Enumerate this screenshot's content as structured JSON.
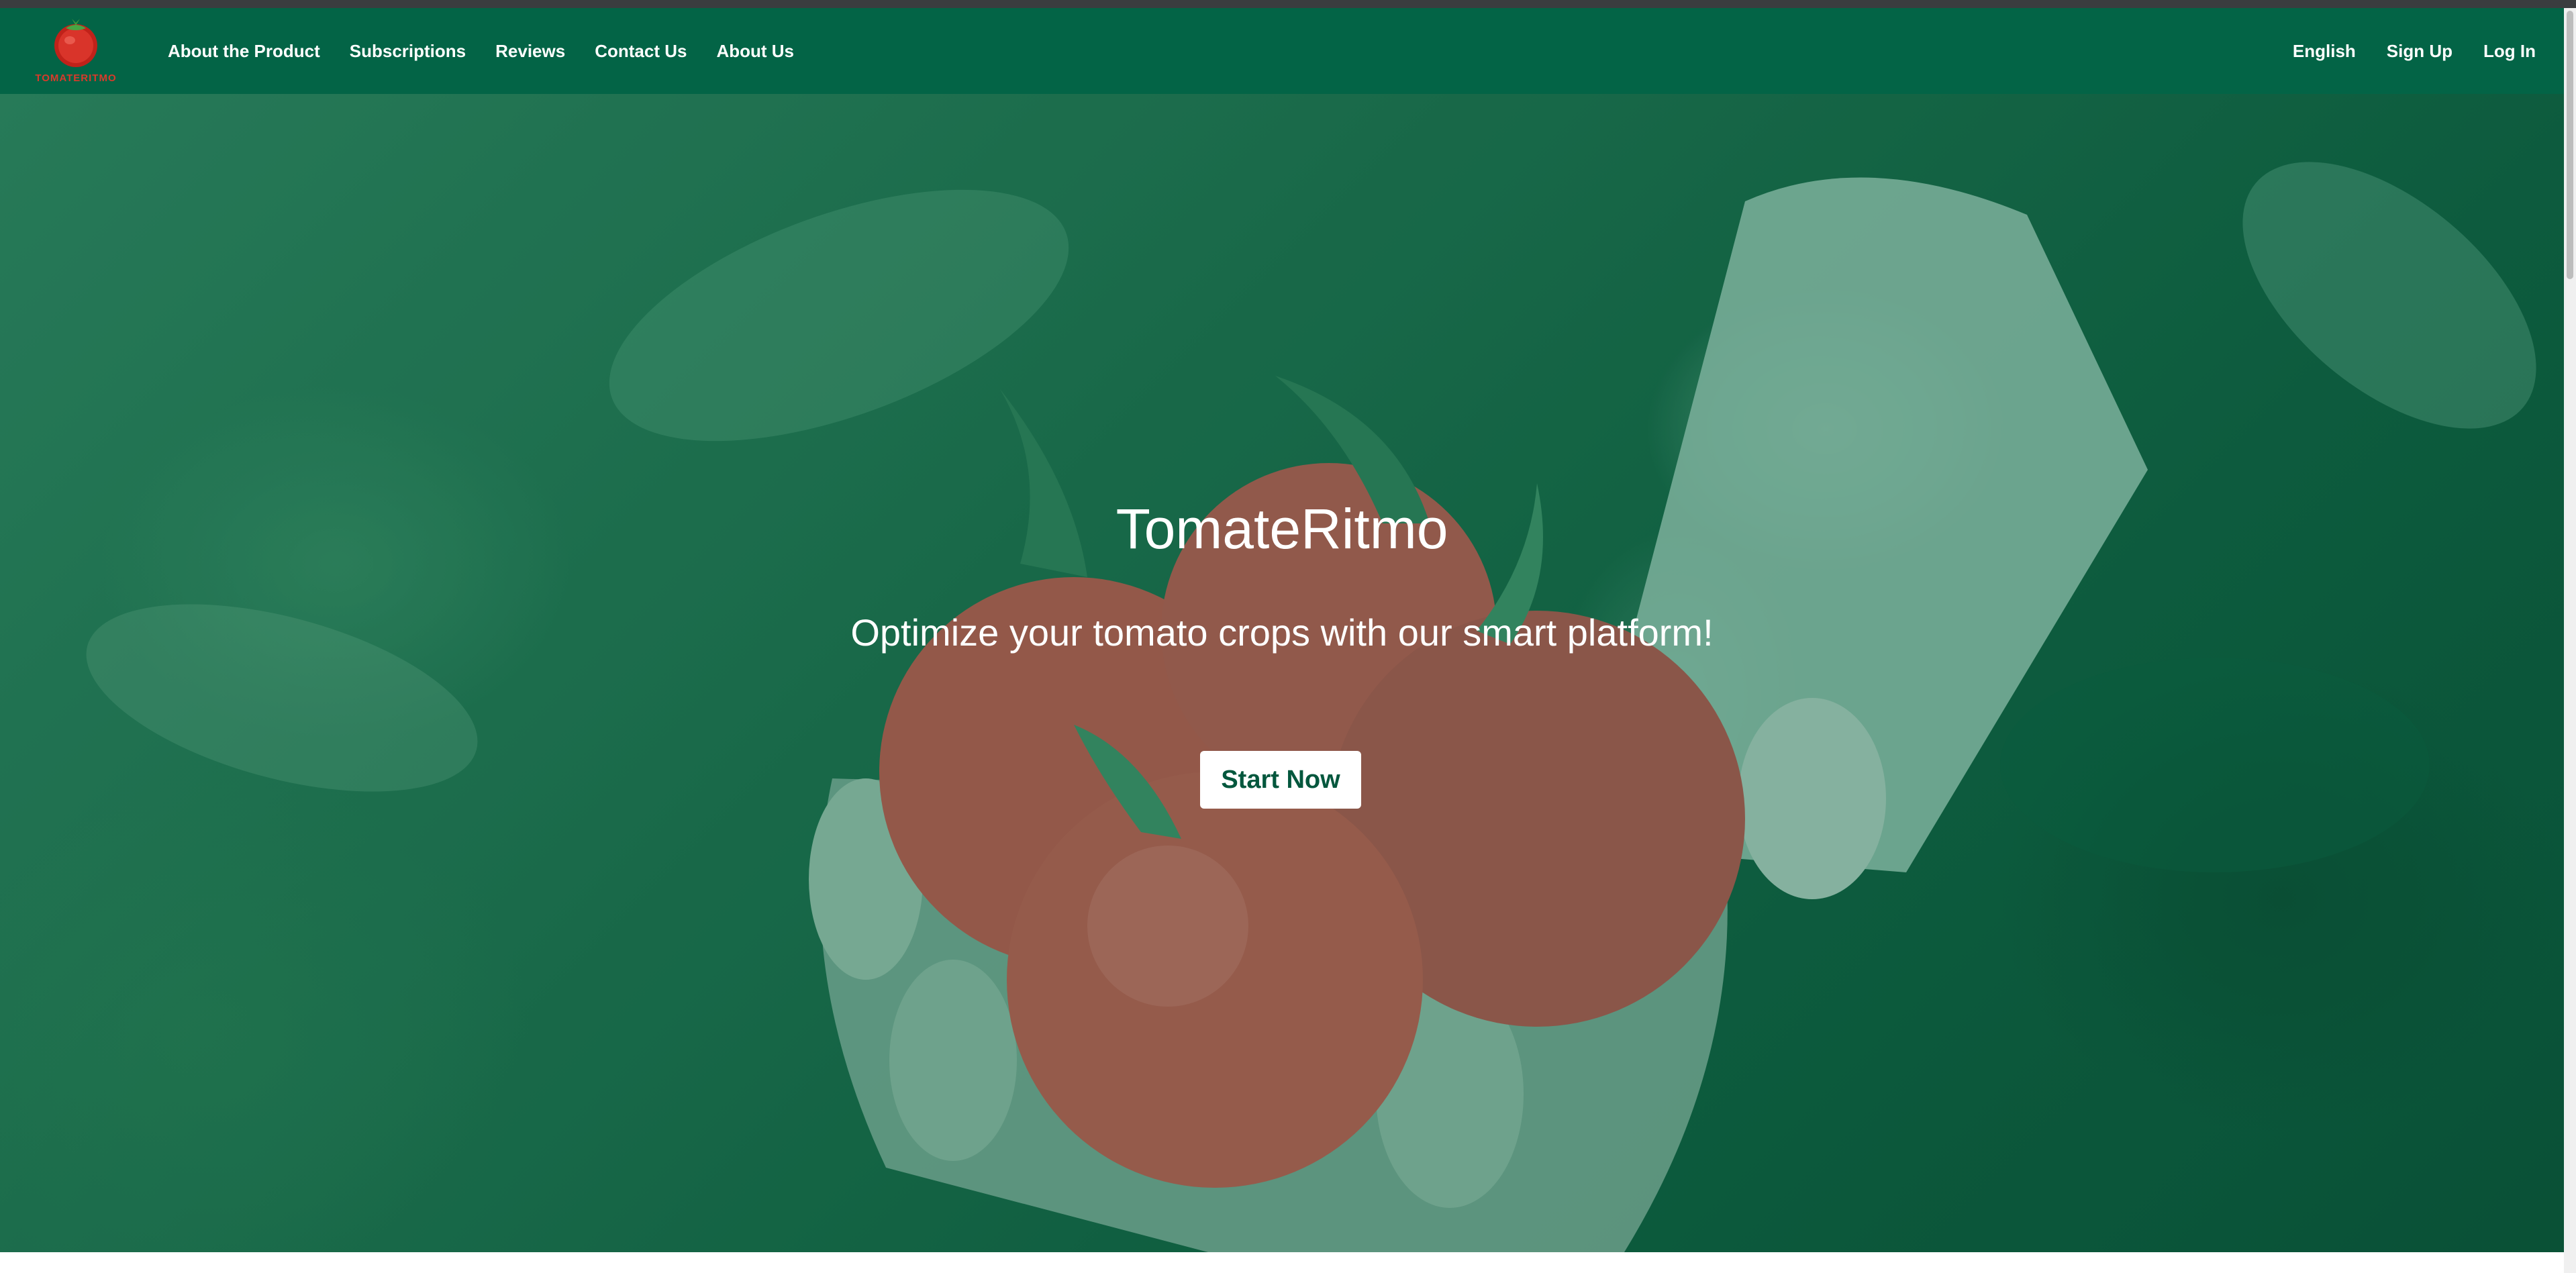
{
  "brand": {
    "logo_text": "TOMATERITMO"
  },
  "nav": {
    "links": [
      "About the Product",
      "Subscriptions",
      "Reviews",
      "Contact Us",
      "About Us"
    ],
    "right": {
      "language": "English",
      "signup": "Sign Up",
      "login": "Log In"
    }
  },
  "hero": {
    "title": "TomateRitmo",
    "subtitle": "Optimize your tomato crops with our smart platform!",
    "cta": "Start Now"
  },
  "colors": {
    "nav_bg": "#036446",
    "cta_text": "#03573d",
    "logo_red": "#d93a2b"
  },
  "icons": {
    "logo": "tomato-logo-icon"
  }
}
